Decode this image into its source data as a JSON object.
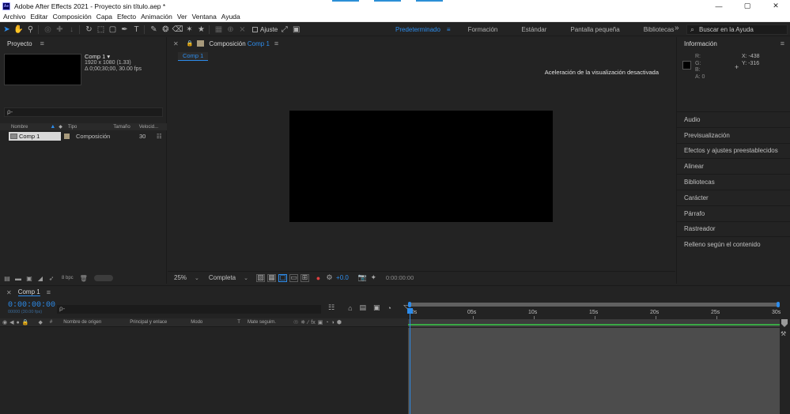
{
  "window": {
    "title": "Adobe After Effects 2021 - Proyecto sin título.aep *",
    "app_icon": "Ae",
    "controls": {
      "minimize": "—",
      "maximize": "▢",
      "close": "✕"
    }
  },
  "menu": [
    "Archivo",
    "Editar",
    "Composición",
    "Capa",
    "Efecto",
    "Animación",
    "Ver",
    "Ventana",
    "Ayuda"
  ],
  "toolbar": {
    "ajuste_label": "Ajuste",
    "workspaces": [
      "Predeterminado",
      "Formación",
      "Estándar",
      "Pantalla pequeña",
      "Bibliotecas"
    ],
    "active_workspace": "Predeterminado",
    "more": "»",
    "help_placeholder": "Buscar en la Ayuda"
  },
  "project": {
    "tab": "Proyecto",
    "selected": {
      "name": "Comp 1 ▾",
      "resolution": "1920 x 1080 (1.33)",
      "duration": "Δ 0;00;30;00, 30.00 fps"
    },
    "search_icon": "ρ-",
    "columns": [
      "Nombre",
      "Tipo",
      "Tamaño",
      "Velocid..."
    ],
    "rows": [
      {
        "name": "Comp 1",
        "type": "Composición",
        "fps": "30"
      }
    ],
    "bpc": "8 bpc"
  },
  "composition": {
    "tab_prefix": "Composición",
    "tab_name": "Comp 1",
    "subtab": "Comp 1",
    "acceleration_note": "Aceleración de la visualización desactivada",
    "zoom": "25%",
    "resolution": "Completa",
    "exposure": "+0.0",
    "timecode": "0:00:00:00"
  },
  "info": {
    "tab": "Información",
    "r": "R:",
    "g": "G:",
    "b": "B:",
    "a": "A:  0",
    "x": "X:  -438",
    "y": "Y:  -316"
  },
  "side_panels": [
    "Audio",
    "Previsualización",
    "Efectos y ajustes preestablecidos",
    "Alinear",
    "Bibliotecas",
    "Carácter",
    "Párrafo",
    "Rastreador",
    "Relleno según el contenido"
  ],
  "timeline": {
    "tab": "Comp 1",
    "current_time": "0:00:00:00",
    "sub_time": "00000 (30.00 fps)",
    "search_icon": "ρ-",
    "columns": [
      "#",
      "Nombre de origen",
      "Principal y enlace",
      "Modo",
      "T",
      "Mate seguim."
    ],
    "ruler": [
      "00s",
      "05s",
      "10s",
      "15s",
      "20s",
      "25s",
      "30s"
    ]
  },
  "colors": {
    "accent": "#2d8ceb",
    "panel_bg": "#232323",
    "work_area_green": "#3aa845"
  }
}
